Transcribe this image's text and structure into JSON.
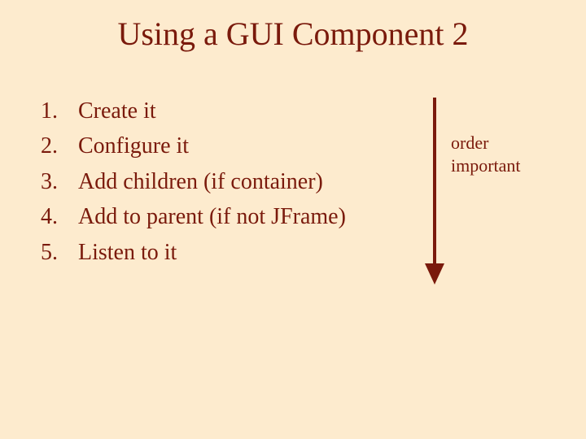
{
  "title": "Using a GUI Component 2",
  "list": {
    "items": [
      {
        "num": "1.",
        "text": "Create it"
      },
      {
        "num": "2.",
        "text": "Configure it"
      },
      {
        "num": "3.",
        "text": "Add children  (if container)"
      },
      {
        "num": "4.",
        "text": "Add to parent  (if not JFrame)"
      },
      {
        "num": "5.",
        "text": "Listen to it"
      }
    ]
  },
  "note": {
    "line1": "order",
    "line2": "important"
  },
  "colors": {
    "background": "#fdebce",
    "text": "#7a1a0c"
  }
}
